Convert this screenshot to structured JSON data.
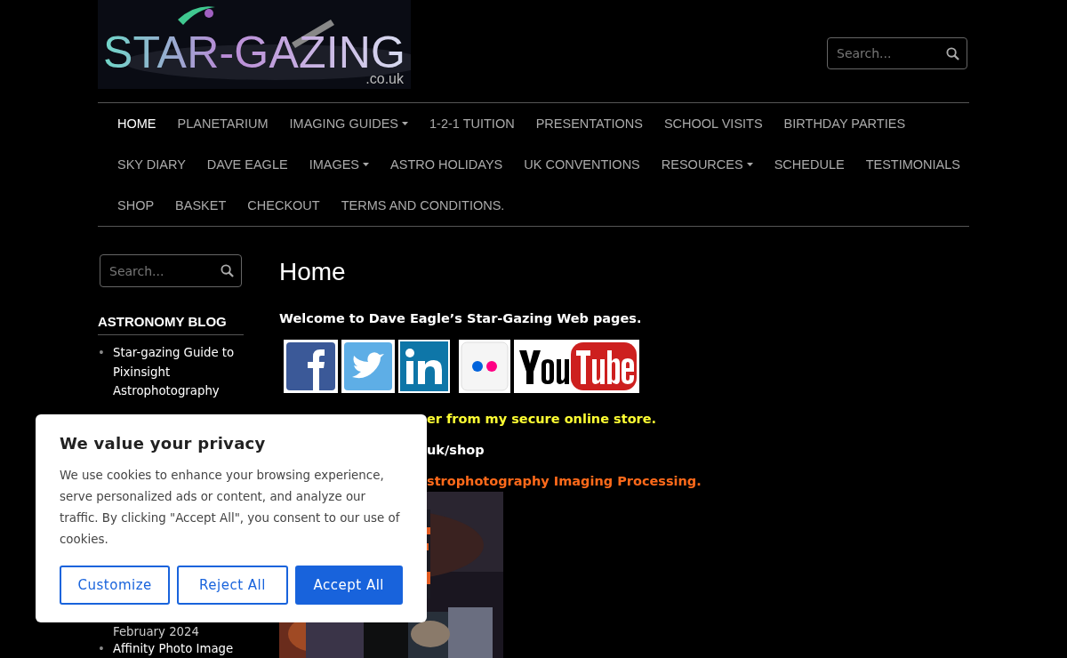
{
  "logo": {
    "title": "STAR-GAZING",
    "domain": ".co.uk"
  },
  "header_search": {
    "placeholder": "Search..."
  },
  "nav": [
    {
      "label": "HOME",
      "selected": true,
      "dropdown": false
    },
    {
      "label": "PLANETARIUM",
      "selected": false,
      "dropdown": false
    },
    {
      "label": "IMAGING GUIDES",
      "selected": false,
      "dropdown": true
    },
    {
      "label": "1-2-1 TUITION",
      "selected": false,
      "dropdown": false
    },
    {
      "label": "PRESENTATIONS",
      "selected": false,
      "dropdown": false
    },
    {
      "label": "SCHOOL VISITS",
      "selected": false,
      "dropdown": false
    },
    {
      "label": "BIRTHDAY PARTIES",
      "selected": false,
      "dropdown": false
    },
    {
      "label": "SKY DIARY",
      "selected": false,
      "dropdown": false
    },
    {
      "label": "DAVE EAGLE",
      "selected": false,
      "dropdown": false
    },
    {
      "label": "IMAGES",
      "selected": false,
      "dropdown": true
    },
    {
      "label": "ASTRO HOLIDAYS",
      "selected": false,
      "dropdown": false
    },
    {
      "label": "UK CONVENTIONS",
      "selected": false,
      "dropdown": false
    },
    {
      "label": "RESOURCES",
      "selected": false,
      "dropdown": true
    },
    {
      "label": "SCHEDULE",
      "selected": false,
      "dropdown": false
    },
    {
      "label": "TESTIMONIALS",
      "selected": false,
      "dropdown": false
    },
    {
      "label": "SHOP",
      "selected": false,
      "dropdown": false
    },
    {
      "label": "BASKET",
      "selected": false,
      "dropdown": false
    },
    {
      "label": "CHECKOUT",
      "selected": false,
      "dropdown": false
    },
    {
      "label": "TERMS AND CONDITIONS.",
      "selected": false,
      "dropdown": false
    }
  ],
  "sidebar": {
    "search": {
      "placeholder": "Search..."
    },
    "heading": "ASTRONOMY BLOG",
    "posts": [
      {
        "bullet": "•",
        "title": "Star-gazing Guide to Pixinsight Astrophotography"
      },
      {
        "date": "February 2024"
      },
      {
        "bullet": "•",
        "title": "Affinity Photo Image"
      }
    ]
  },
  "main": {
    "title": "Home",
    "welcome": "Welcome to Dave Eagle’s Star-Gazing Web pages.",
    "social": [
      {
        "kind": "facebook"
      },
      {
        "kind": "twitter"
      },
      {
        "kind": "linkedin"
      },
      {
        "kind": "flickr"
      },
      {
        "kind": "youtube"
      }
    ],
    "lines": [
      {
        "text": "er from my secure online store.",
        "color": "#ffff33"
      },
      {
        "text": "uk/shop",
        "color": "#ffffff"
      },
      {
        "text": "strophotography Imaging Processing.",
        "color": "#ff6a1a"
      }
    ]
  },
  "cookie": {
    "title": "We value your privacy",
    "text": "We use cookies to enhance your browsing experience, serve personalized ads or content, and analyze our traffic. By clicking \"Accept All\", you consent to our use of cookies.",
    "buttons": [
      {
        "label": "Customize",
        "kind": "outline"
      },
      {
        "label": "Reject All",
        "kind": "outline"
      },
      {
        "label": "Accept All",
        "kind": "primary"
      }
    ]
  }
}
